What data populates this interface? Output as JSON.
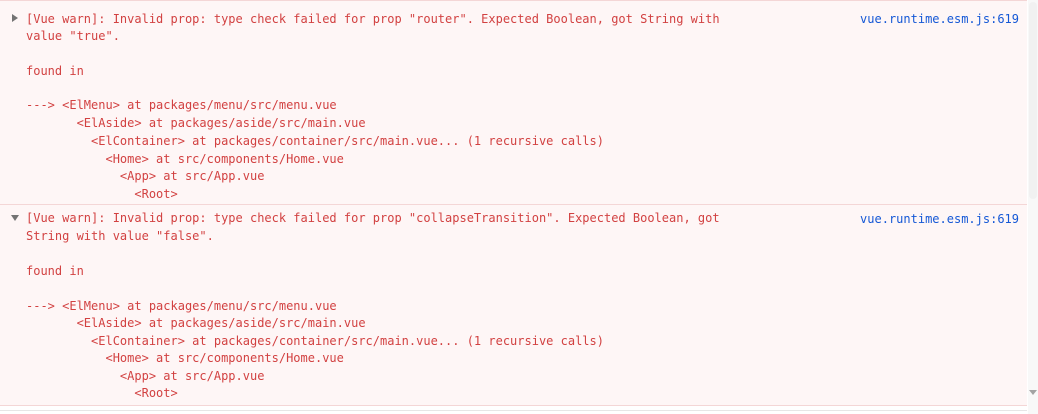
{
  "colors": {
    "warning_text": "#d24141",
    "warning_background": "#fef6f6",
    "link": "#1558d6"
  },
  "messages": [
    {
      "expanded": false,
      "source": "vue.runtime.esm.js:619",
      "lines": [
        "[Vue warn]: Invalid prop: type check failed for prop \"router\". Expected Boolean, got String with",
        "value \"true\".",
        "",
        "found in",
        "",
        "---> <ElMenu> at packages/menu/src/menu.vue",
        "       <ElAside> at packages/aside/src/main.vue",
        "         <ElContainer> at packages/container/src/main.vue... (1 recursive calls)",
        "           <Home> at src/components/Home.vue",
        "             <App> at src/App.vue",
        "               <Root>"
      ]
    },
    {
      "expanded": true,
      "source": "vue.runtime.esm.js:619",
      "lines": [
        "[Vue warn]: Invalid prop: type check failed for prop \"collapseTransition\". Expected Boolean, got",
        "String with value \"false\".",
        "",
        "found in",
        "",
        "---> <ElMenu> at packages/menu/src/menu.vue",
        "       <ElAside> at packages/aside/src/main.vue",
        "         <ElContainer> at packages/container/src/main.vue... (1 recursive calls)",
        "           <Home> at src/components/Home.vue",
        "             <App> at src/App.vue",
        "               <Root>"
      ]
    }
  ]
}
